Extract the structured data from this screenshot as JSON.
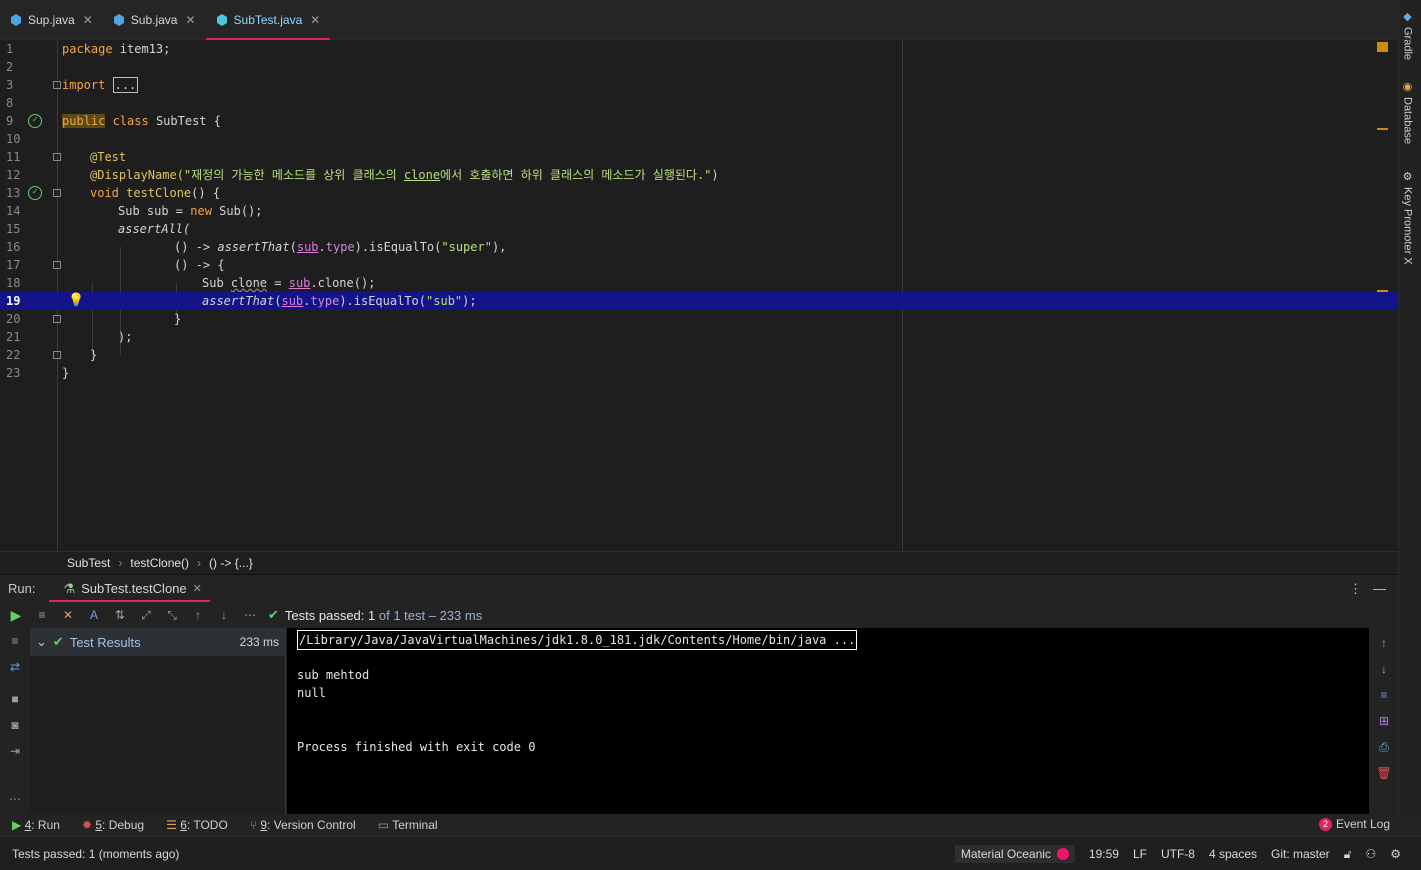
{
  "tabs": [
    {
      "label": "Sup.java"
    },
    {
      "label": "Sub.java"
    },
    {
      "label": "SubTest.java",
      "active": true
    }
  ],
  "right_tools": [
    "Gradle",
    "Database",
    "Key Promoter X"
  ],
  "editor": {
    "line_numbers": [
      "1",
      "2",
      "3",
      "8",
      "9",
      "10",
      "11",
      "12",
      "13",
      "14",
      "15",
      "16",
      "17",
      "18",
      "19",
      "20",
      "21",
      "22",
      "23"
    ],
    "current_line": "19"
  },
  "code": {
    "l1_kw": "package",
    "l1_rest": " item13;",
    "l3_kw": "import",
    "l3_collapsed": "...",
    "l9_kw1": "public",
    "l9_kw2": " class",
    "l9_rest": " SubTest {",
    "l11_ann": "@Test",
    "l12_ann": "@DisplayName(",
    "l12_str1": "\"재정의 가능한 메소드를 상위 클래스의 ",
    "l12_clone": "clone",
    "l12_str2": "에서 호출하면 하위 클래스의 메소드가 실행된다.\"",
    "l12_end": ")",
    "l13_kw": "void",
    "l13_fn": " testClone",
    "l13_rest": "() {",
    "l14_a": "Sub sub = ",
    "l14_kw": "new",
    "l14_b": " Sub();",
    "l15": "assertAll(",
    "l16_a": "() -> ",
    "l16_fn": "assertThat",
    "l16_b": "(",
    "l16_sub": "sub",
    "l16_c": ".",
    "l16_type": "type",
    "l16_d": ").isEqualTo(",
    "l16_str": "\"super\"",
    "l16_e": "),",
    "l17": "() -> {",
    "l18_a": "Sub ",
    "l18_clone": "clone",
    "l18_b": " = ",
    "l18_sub": "sub",
    "l18_c": ".clone();",
    "l19_fn": "assertThat",
    "l19_b": "(",
    "l19_sub": "sub",
    "l19_c": ".",
    "l19_type": "type",
    "l19_d": ").isEqualTo(",
    "l19_str": "\"sub\"",
    "l19_e": ");",
    "l20": "}",
    "l21": ");",
    "l22": "}",
    "l23": "}"
  },
  "breadcrumb": [
    "SubTest",
    "testClone()",
    "() -> {...}"
  ],
  "run": {
    "label": "Run:",
    "tab": "SubTest.testClone",
    "passed_prefix": "Tests passed: ",
    "passed_count": "1",
    "passed_of": " of 1 test – 233 ms",
    "results_label": "Test Results",
    "results_ms": "233 ms"
  },
  "console": {
    "lines": [
      "/Library/Java/JavaVirtualMachines/jdk1.8.0_181.jdk/Contents/Home/bin/java ...",
      "",
      "sub mehtod",
      "null",
      "",
      "",
      "Process finished with exit code 0"
    ]
  },
  "bottom_tools": [
    {
      "num": "4",
      "label": ": Run"
    },
    {
      "num": "5",
      "label": ": Debug"
    },
    {
      "num": "6",
      "label": ": TODO"
    },
    {
      "num": "9",
      "label": ": Version Control"
    },
    {
      "num": "",
      "label": "Terminal"
    }
  ],
  "event_log": {
    "count": "2",
    "label": "Event Log"
  },
  "status": {
    "message": "Tests passed: 1 (moments ago)",
    "theme": "Material Oceanic",
    "position": "19:59",
    "line_sep": "LF",
    "encoding": "UTF-8",
    "indent": "4 spaces",
    "git": "Git: master"
  },
  "colors": {
    "accent": "#e0245e",
    "current_line": "#14148a",
    "keyword": "#f6a546",
    "string": "#b8e07a"
  }
}
